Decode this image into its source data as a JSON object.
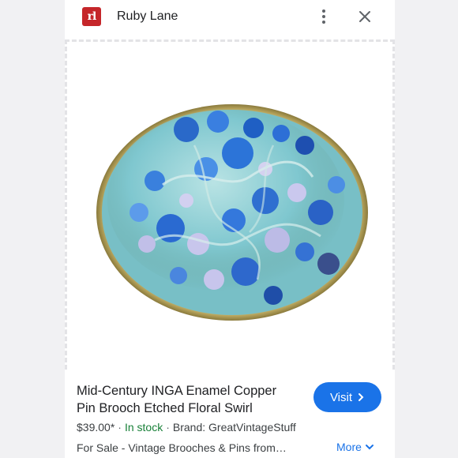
{
  "header": {
    "logo_text": "rl",
    "site_name": "Ruby Lane"
  },
  "product": {
    "image_icon": "enamel-brooch-image",
    "title": "Mid-Century INGA Enamel Copper Pin Brooch Etched Floral Swirl",
    "price": "$39.00*",
    "stock": "In stock",
    "brand": "Brand: GreatVintageStuff",
    "category": "For Sale - Vintage Brooches & Pins from…"
  },
  "actions": {
    "visit_label": "Visit",
    "more_label": "More"
  },
  "colors": {
    "brand": "#c5262a",
    "accent": "#1a73e8",
    "stock": "#188038"
  }
}
